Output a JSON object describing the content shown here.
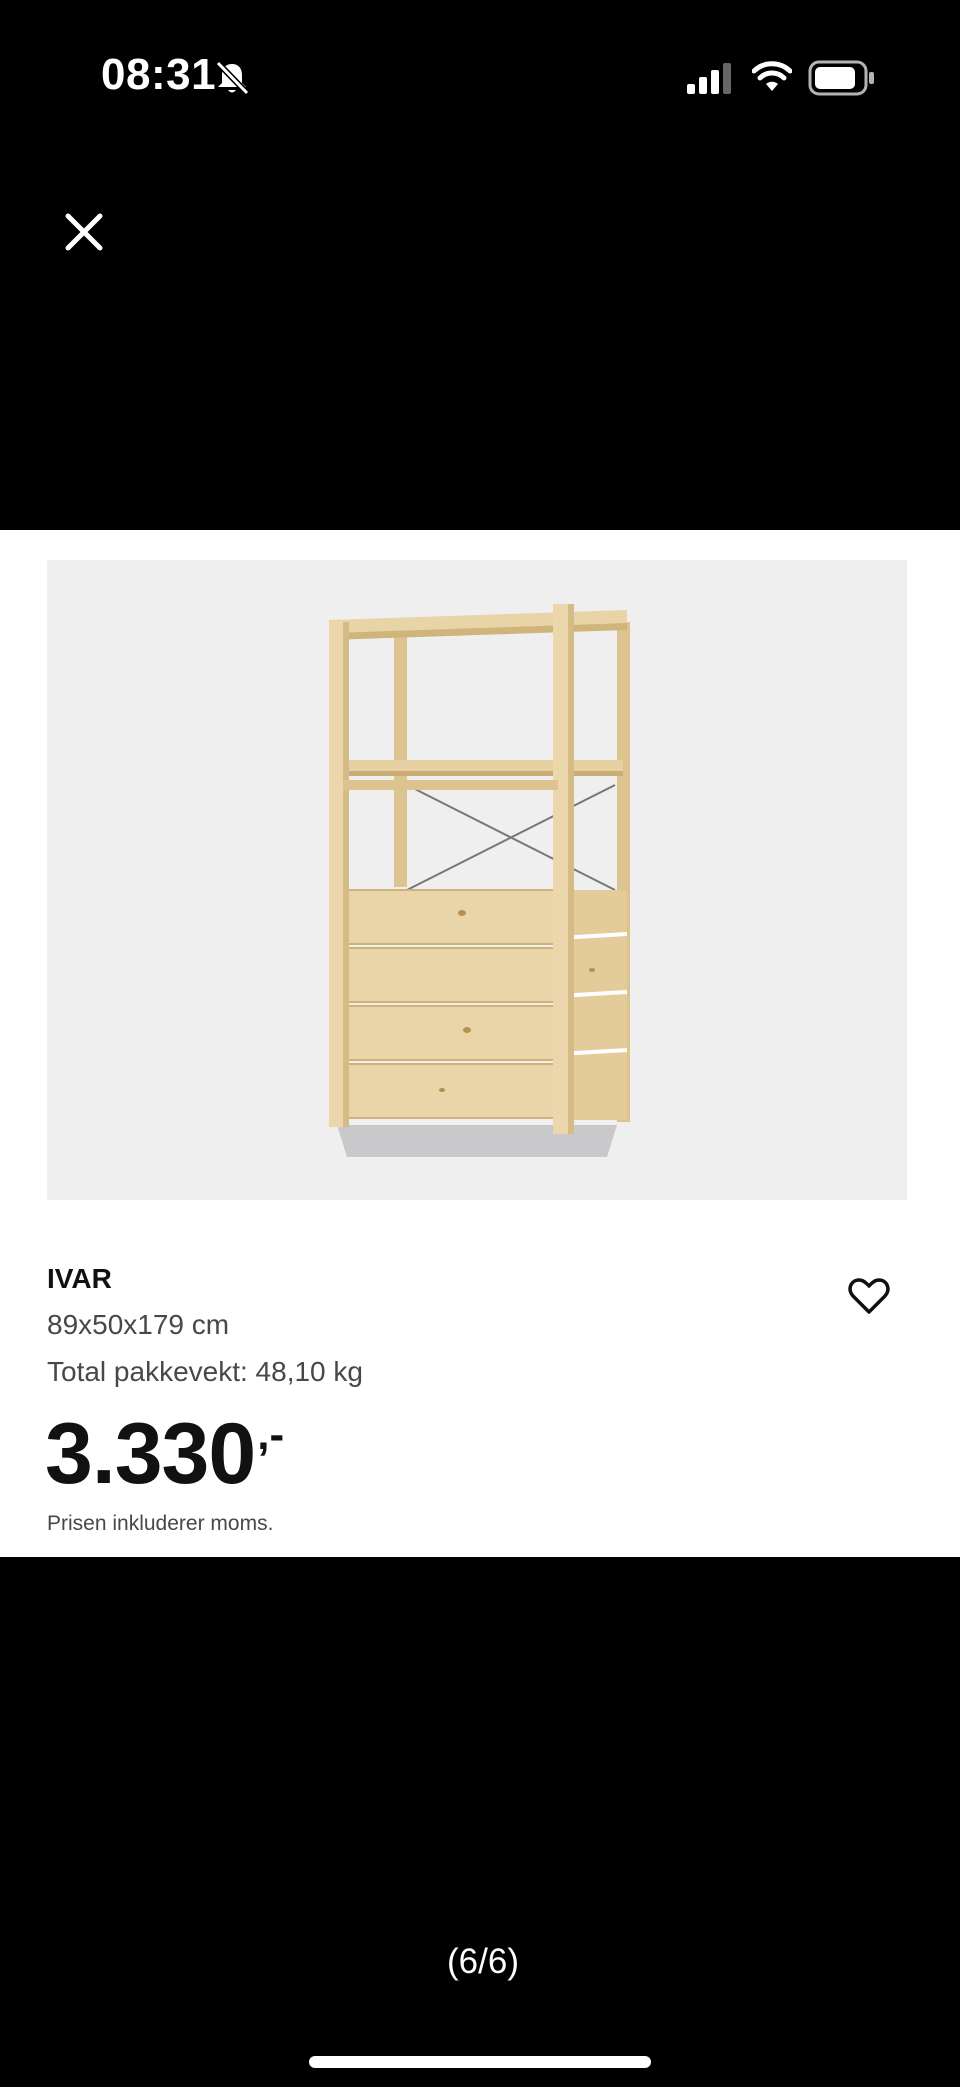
{
  "status_bar": {
    "time": "08:31",
    "icons": [
      "bell-slash-icon",
      "cellular-signal-icon",
      "wifi-icon",
      "battery-icon"
    ]
  },
  "viewer": {
    "close_icon": "close-icon",
    "counter": "(6/6)"
  },
  "product": {
    "image_icon": "ivar-shelving-unit-image",
    "name": "IVAR",
    "dimensions": "89x50x179 cm",
    "weight": "Total pakkevekt: 48,10 kg",
    "price_main": "3.330",
    "price_suffix": ",-",
    "vat_note": "Prisen inkluderer moms.",
    "favorite_icon": "heart-icon"
  },
  "colors": {
    "background": "#000000",
    "card": "#ffffff",
    "image_bg": "#f0eff0",
    "text": "#111111",
    "muted_text": "#484848",
    "wood": "#e8d3a5"
  }
}
